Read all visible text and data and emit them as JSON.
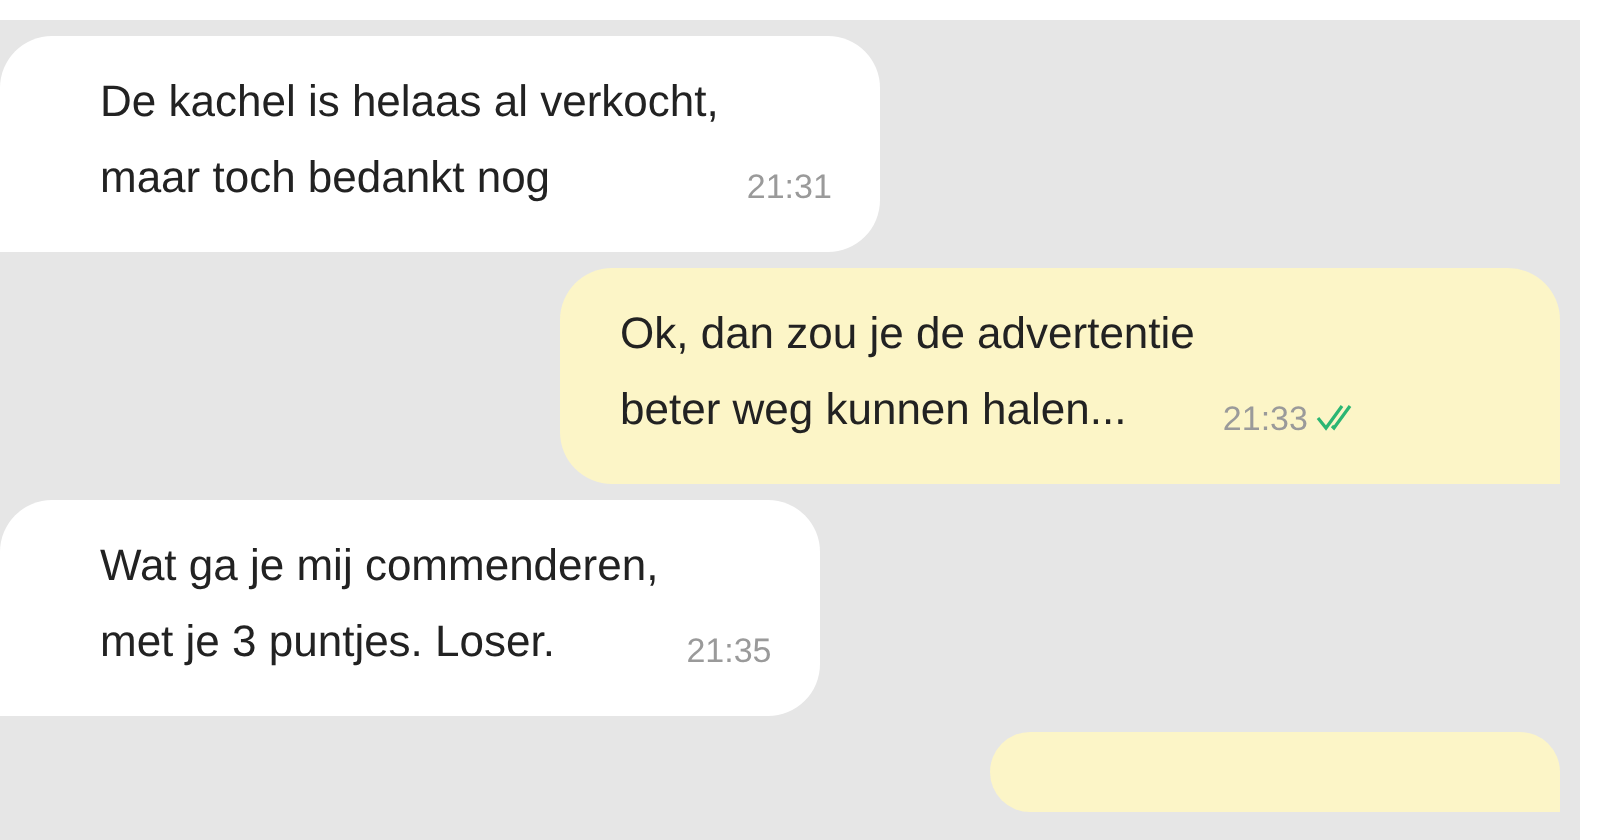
{
  "messages": [
    {
      "kind": "incoming",
      "lines": [
        "De kachel is helaas al verkocht,",
        "maar toch bedankt nog"
      ],
      "time": "21:31"
    },
    {
      "kind": "outgoing",
      "lines": [
        "Ok, dan zou je de advertentie",
        "beter weg kunnen halen..."
      ],
      "time": "21:33",
      "read": true
    },
    {
      "kind": "incoming",
      "lines": [
        "Wat ga je mij commenderen,",
        "met je 3 puntjes. Loser."
      ],
      "time": "21:35"
    },
    {
      "kind": "outgoing"
    }
  ]
}
